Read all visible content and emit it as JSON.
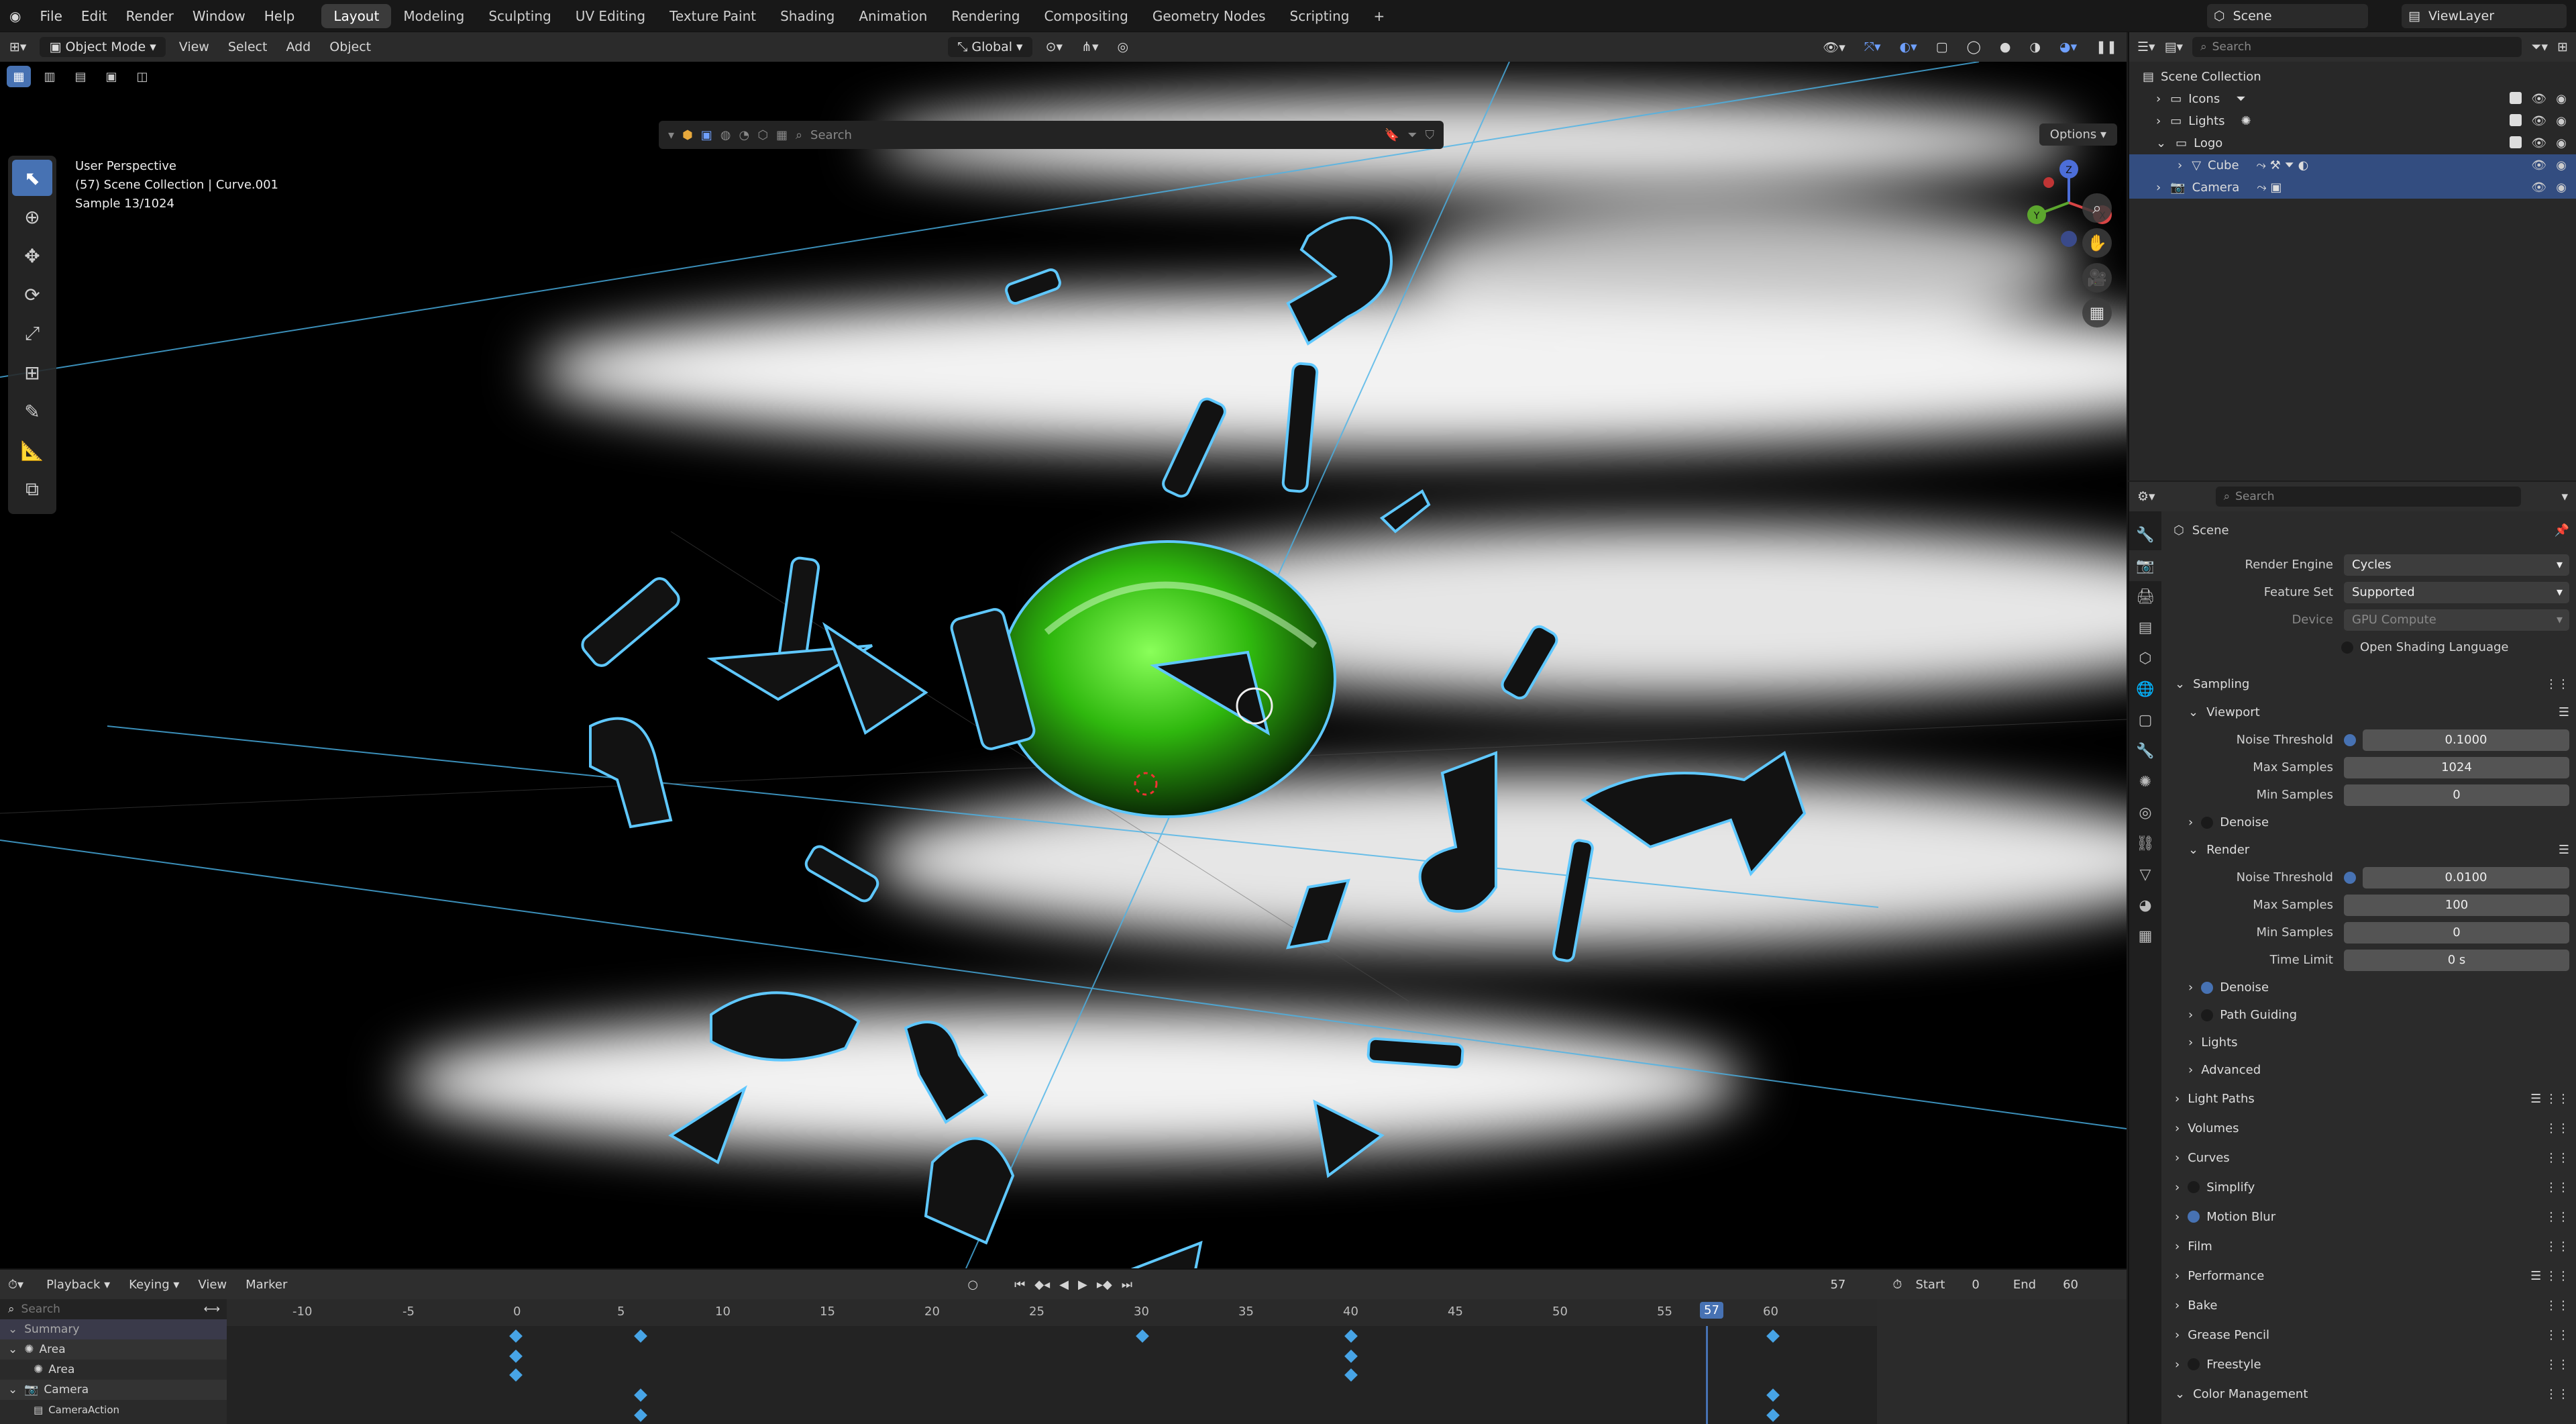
{
  "menu": {
    "items": [
      "File",
      "Edit",
      "Render",
      "Window",
      "Help"
    ]
  },
  "workspaces": [
    "Layout",
    "Modeling",
    "Sculpting",
    "UV Editing",
    "Texture Paint",
    "Shading",
    "Animation",
    "Rendering",
    "Compositing",
    "Geometry Nodes",
    "Scripting"
  ],
  "top_right": {
    "scene": "Scene",
    "view_layer": "ViewLayer"
  },
  "viewport_header": {
    "mode": "Object Mode",
    "menus": [
      "View",
      "Select",
      "Add",
      "Object"
    ],
    "orientation": "Global",
    "options": "Options",
    "search_placeholder": "Search"
  },
  "viewport_info": {
    "line1": "User Perspective",
    "line2": "(57) Scene Collection | Curve.001",
    "line3": "Sample 13/1024"
  },
  "gizmo_axes": [
    "X",
    "Y",
    "Z"
  ],
  "outliner": {
    "search_placeholder": "Search",
    "items": [
      {
        "label": "Scene Collection",
        "indent": 0,
        "selected": false
      },
      {
        "label": "Icons",
        "indent": 1,
        "selected": false
      },
      {
        "label": "Lights",
        "indent": 1,
        "selected": false
      },
      {
        "label": "Logo",
        "indent": 1,
        "selected": false
      },
      {
        "label": "Cube",
        "indent": 2,
        "selected": true
      },
      {
        "label": "Camera",
        "indent": 1,
        "selected": true
      }
    ]
  },
  "properties": {
    "search_placeholder": "Search",
    "context": "Scene",
    "render_engine_label": "Render Engine",
    "render_engine": "Cycles",
    "feature_set_label": "Feature Set",
    "feature_set": "Supported",
    "device_label": "Device",
    "device": "GPU Compute",
    "osl": "Open Shading Language",
    "sampling": "Sampling",
    "viewport": "Viewport",
    "vp_noise_label": "Noise Threshold",
    "vp_noise": "0.1000",
    "vp_max_label": "Max Samples",
    "vp_max": "1024",
    "vp_min_label": "Min Samples",
    "vp_min": "0",
    "denoise": "Denoise",
    "render": "Render",
    "r_noise_label": "Noise Threshold",
    "r_noise": "0.0100",
    "r_max_label": "Max Samples",
    "r_max": "100",
    "r_min_label": "Min Samples",
    "r_min": "0",
    "time_limit_label": "Time Limit",
    "time_limit": "0 s",
    "r_denoise": "Denoise",
    "path_guiding": "Path Guiding",
    "lights": "Lights",
    "advanced": "Advanced",
    "sections": [
      "Light Paths",
      "Volumes",
      "Curves",
      "Simplify",
      "Motion Blur",
      "Film",
      "Performance",
      "Bake",
      "Grease Pencil",
      "Freestyle",
      "Color Management"
    ]
  },
  "timeline": {
    "menus": [
      "Playback",
      "Keying",
      "View",
      "Marker"
    ],
    "current_frame": "57",
    "start_label": "Start",
    "start": "0",
    "end_label": "End",
    "end": "60",
    "search_placeholder": "Search",
    "ticks": [
      "-10",
      "-5",
      "0",
      "5",
      "10",
      "15",
      "20",
      "25",
      "30",
      "35",
      "40",
      "45",
      "50",
      "55",
      "57",
      "60"
    ],
    "channels": [
      "Summary",
      "Area",
      "Area",
      "Camera",
      "CameraAction"
    ]
  },
  "colors": {
    "accent": "#4772b3",
    "selection_outline": "#5fc8ff",
    "object_green": "#43d11a"
  }
}
